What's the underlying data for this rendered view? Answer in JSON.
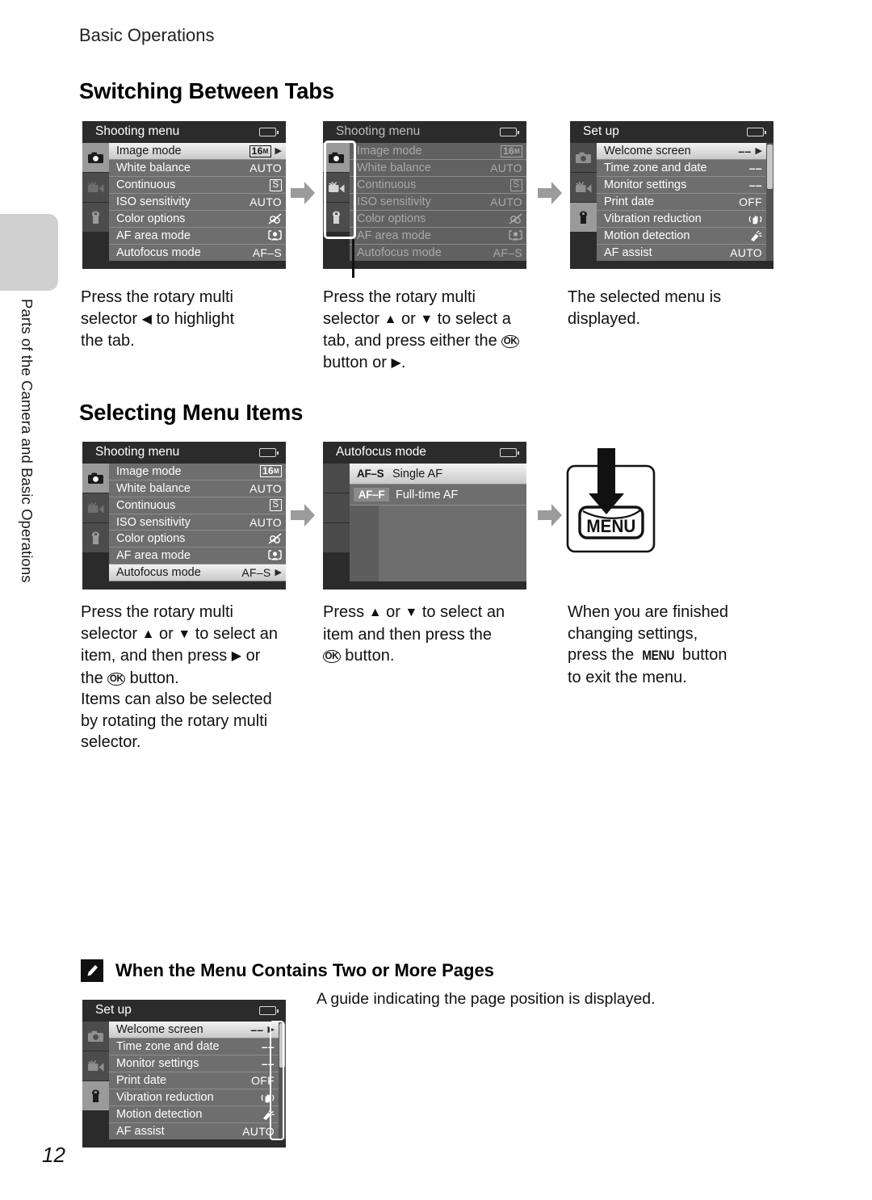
{
  "page": {
    "running_head": "Basic Operations",
    "chapter_tab_label": "Parts of the Camera and Basic Operations",
    "page_number": "12"
  },
  "sections": [
    {
      "heading": "Switching Between Tabs",
      "captions": [
        {
          "lines": [
            "Press the rotary multi",
            "selector ◀ to highlight",
            "the tab."
          ]
        },
        {
          "lines": [
            "Press the rotary multi",
            "selector ▲ or ▼ to select a",
            "tab, and press either the OK",
            "button or ▶."
          ]
        },
        {
          "lines": [
            "The selected menu is",
            "displayed."
          ]
        }
      ]
    },
    {
      "heading": "Selecting Menu Items",
      "captions": [
        {
          "lines": [
            "Press the rotary multi",
            "selector ▲ or ▼ to select an",
            "item, and then press ▶ or",
            "the OK button.",
            "Items can also be selected",
            "by rotating the rotary multi",
            "selector."
          ]
        },
        {
          "lines": [
            "Press ▲ or ▼ to select an",
            "item and then press the",
            "OK button."
          ]
        },
        {
          "lines": [
            "When you are finished",
            "changing settings,",
            "press the MENU button",
            "to exit the menu."
          ]
        }
      ]
    }
  ],
  "screens": {
    "shooting_menu_title": "Shooting menu",
    "setup_menu_title": "Set up",
    "autofocus_title": "Autofocus mode",
    "tabs": [
      "shooting-tab-icon",
      "movie-tab-icon",
      "setup-tab-icon"
    ],
    "shooting_items": [
      {
        "label": "Image mode",
        "value": "16M",
        "value_kind": "image-badge"
      },
      {
        "label": "White balance",
        "value": "AUTO",
        "value_kind": "text"
      },
      {
        "label": "Continuous",
        "value": "S",
        "value_kind": "box"
      },
      {
        "label": "ISO sensitivity",
        "value": "AUTO",
        "value_kind": "text"
      },
      {
        "label": "Color options",
        "value": "",
        "value_kind": "color-icon"
      },
      {
        "label": "AF area mode",
        "value": "",
        "value_kind": "face-icon"
      },
      {
        "label": "Autofocus mode",
        "value": "AF–S",
        "value_kind": "text"
      }
    ],
    "setup_items": [
      {
        "label": "Welcome screen",
        "value": "––",
        "value_kind": "dash"
      },
      {
        "label": "Time zone and date",
        "value": "––",
        "value_kind": "dash"
      },
      {
        "label": "Monitor settings",
        "value": "––",
        "value_kind": "dash"
      },
      {
        "label": "Print date",
        "value": "OFF",
        "value_kind": "text"
      },
      {
        "label": "Vibration reduction",
        "value": "",
        "value_kind": "vr-icon"
      },
      {
        "label": "Motion detection",
        "value": "",
        "value_kind": "motion-icon"
      },
      {
        "label": "AF assist",
        "value": "AUTO",
        "value_kind": "text"
      }
    ],
    "autofocus_options": [
      {
        "code": "AF–S",
        "label": "Single AF"
      },
      {
        "code": "AF–F",
        "label": "Full-time AF"
      }
    ],
    "menu_button_label": "MENU"
  },
  "note": {
    "title": "When the Menu Contains Two or More Pages",
    "body": "A guide indicating the page position is displayed."
  }
}
